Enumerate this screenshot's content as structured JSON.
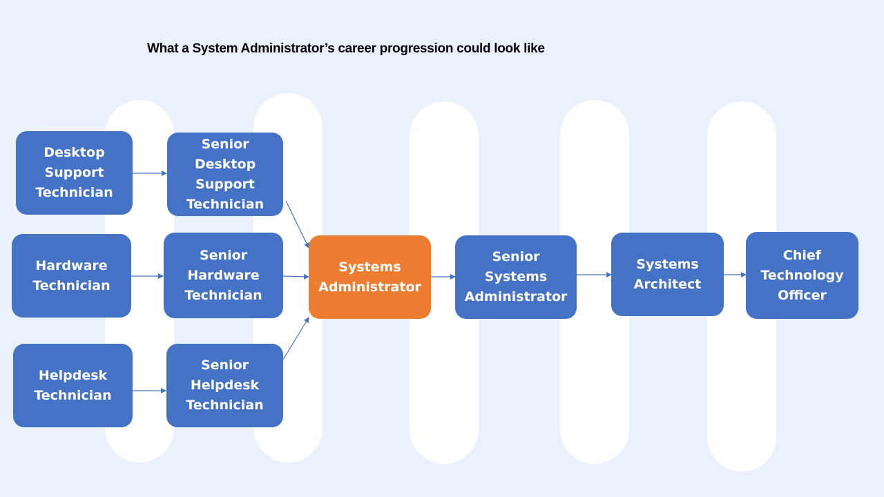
{
  "title": "What a System Administrator’s career progression could look like",
  "colors": {
    "background": "#EAF1FB",
    "box": "#4472C4",
    "highlight": "#ED7D31",
    "arrow": "#4472C4",
    "column": "#FFFFFF"
  },
  "nodes": {
    "desktop_support": "Desktop Support Technician",
    "hardware": "Hardware Technician",
    "helpdesk": "Helpdesk Technician",
    "senior_desktop_support": "Senior Desktop Support Technician",
    "senior_hardware": "Senior Hardware Technician",
    "senior_helpdesk": "Senior Helpdesk Technician",
    "systems_admin": "Systems Administrator",
    "senior_systems_admin": "Senior Systems Administrator",
    "systems_architect": "Systems Architect",
    "cto": "Chief Technology Officer"
  },
  "edges": [
    [
      "desktop_support",
      "senior_desktop_support"
    ],
    [
      "hardware",
      "senior_hardware"
    ],
    [
      "helpdesk",
      "senior_helpdesk"
    ],
    [
      "senior_desktop_support",
      "systems_admin"
    ],
    [
      "senior_hardware",
      "systems_admin"
    ],
    [
      "senior_helpdesk",
      "systems_admin"
    ],
    [
      "systems_admin",
      "senior_systems_admin"
    ],
    [
      "senior_systems_admin",
      "systems_architect"
    ],
    [
      "systems_architect",
      "cto"
    ]
  ]
}
